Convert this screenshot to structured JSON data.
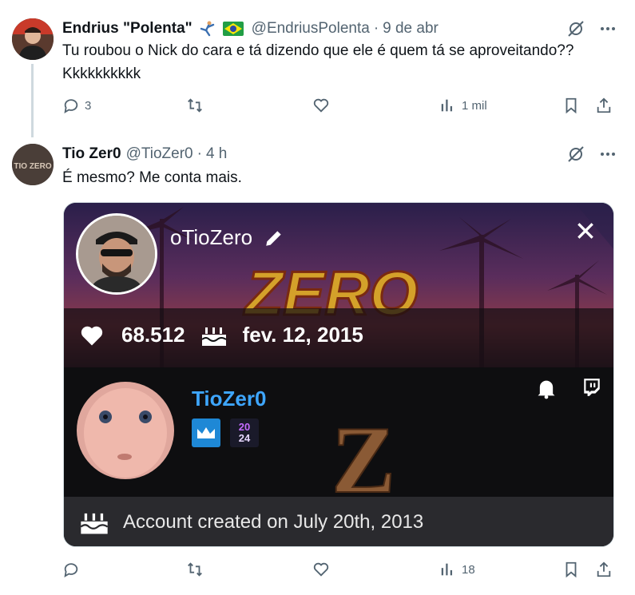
{
  "tweet1": {
    "display_name": "Endrius \"Polenta\"",
    "handle": "@EndriusPolenta",
    "separator": "·",
    "time": "9 de abr",
    "text_line1": "Tu roubou o Nick do cara e tá dizendo que ele é quem tá se aproveitando??",
    "text_line2": "Kkkkkkkkkk",
    "reply_count": "3",
    "views": "1 mil",
    "emojis": [
      "person-kicking-icon",
      "brazil-flag-icon"
    ]
  },
  "tweet2": {
    "display_name": "Tio Zer0",
    "handle": "@TioZer0",
    "separator": "·",
    "time": "4 h",
    "text": "É mesmo? Me conta mais.",
    "avatar_text": "TIO ZERO",
    "views": "18"
  },
  "media": {
    "username": "oTioZero",
    "logo_text": "ZERO",
    "followers": "68.512",
    "created_date": "fev. 12, 2015",
    "twitch_name": "TioZer0",
    "badge_year_top": "20",
    "badge_year_bottom": "24",
    "big_letter": "Z",
    "account_created": "Account created on July 20th, 2013"
  },
  "colors": {
    "text": "#0f1419",
    "secondary": "#536471",
    "twitch_blue": "#3ea6ff",
    "divider": "#cfd9de"
  }
}
